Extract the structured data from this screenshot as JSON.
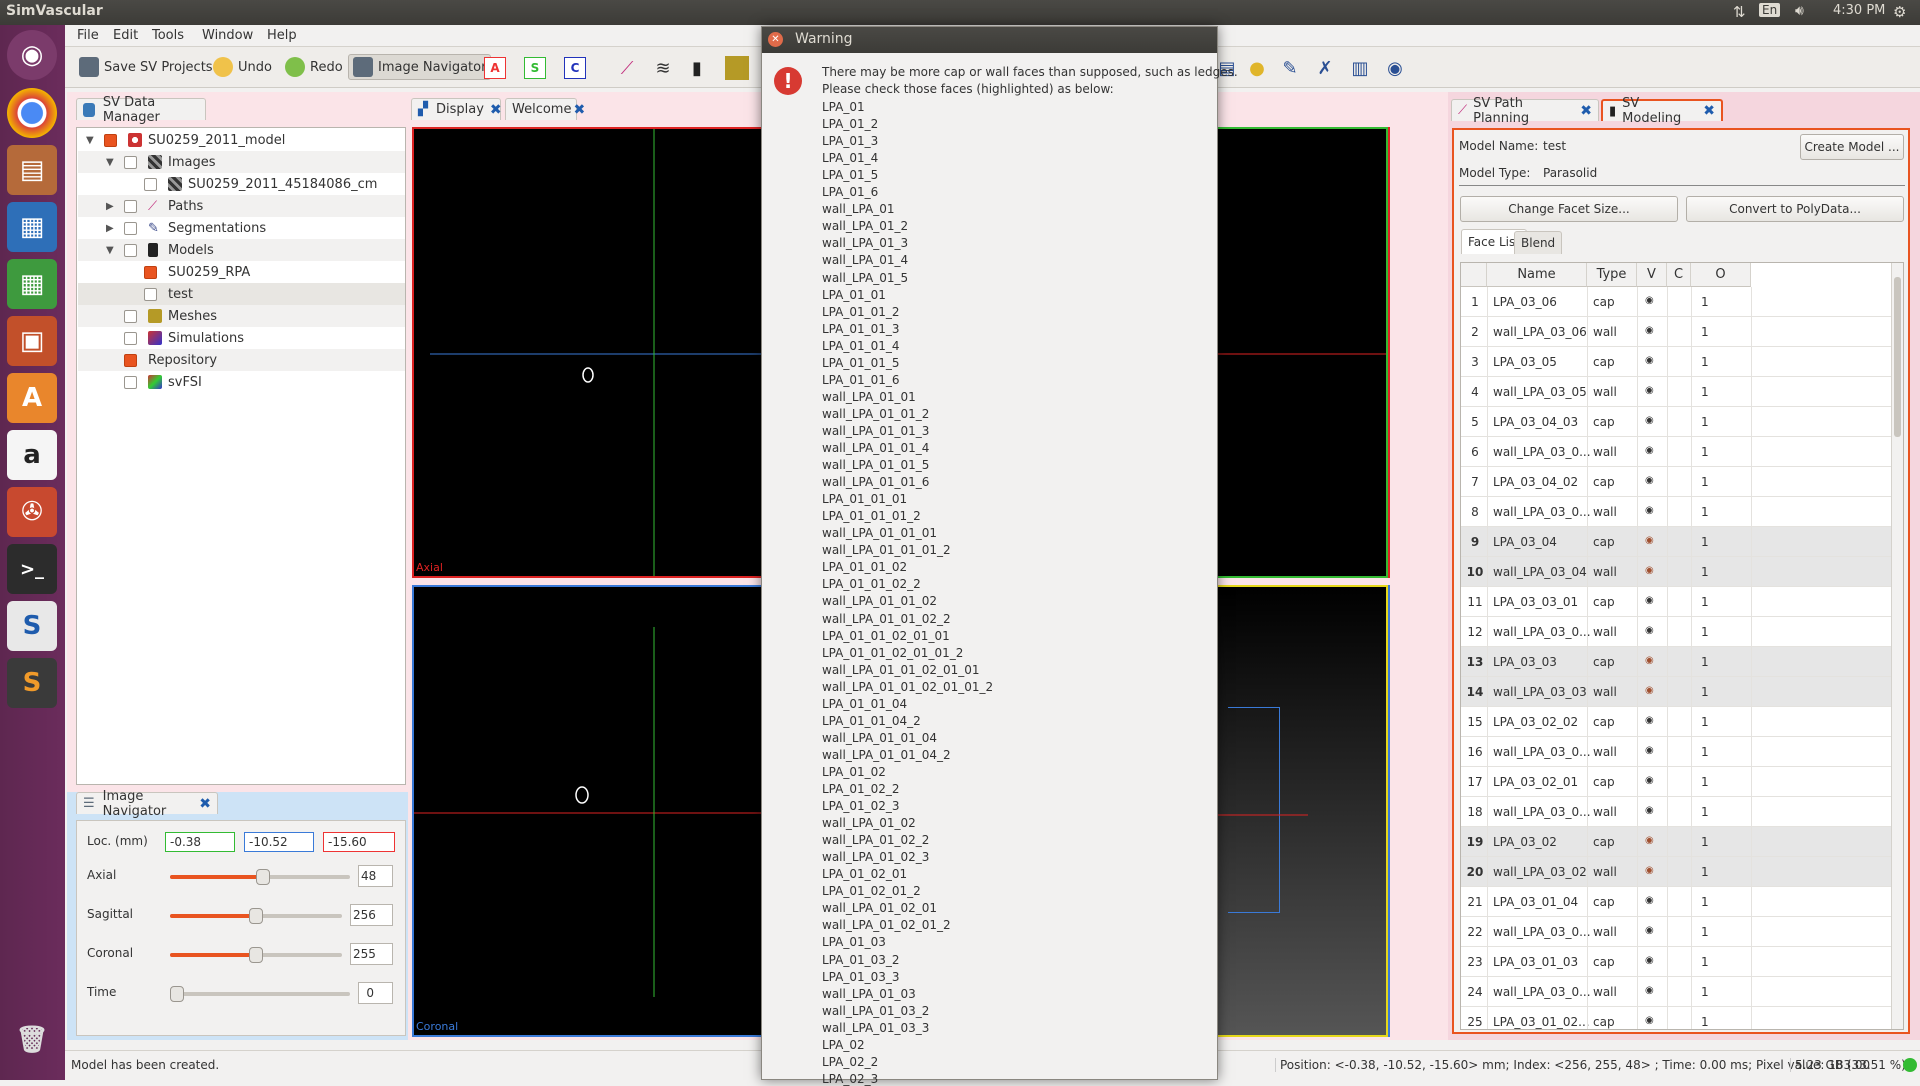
{
  "topbar": {
    "app_title": "SimVascular",
    "keyboard": "En",
    "time": "4:30 PM"
  },
  "launcher": {
    "items": [
      "ubuntu-logo-icon",
      "chrome-icon",
      "files-icon",
      "writer-icon",
      "calc-icon",
      "impress-icon",
      "software-center-icon",
      "amazon-icon",
      "settings-icon",
      "terminal-icon",
      "simvascular-icon",
      "sublime-icon",
      "trash-icon"
    ]
  },
  "menubar": {
    "file": "File",
    "edit": "Edit",
    "tools": "Tools",
    "window": "Window",
    "help": "Help"
  },
  "toolbar": {
    "save": "Save SV Projects",
    "undo": "Undo",
    "redo": "Redo",
    "image_navigator": "Image Navigator",
    "view_a": "A",
    "view_s": "S",
    "view_c": "C"
  },
  "left_dock": {
    "data_manager_tab": "SV Data Manager",
    "tree": [
      {
        "label": "SU0259_2011_model",
        "level": 0,
        "expanded": true
      },
      {
        "label": "Images",
        "level": 1,
        "expanded": true
      },
      {
        "label": "SU0259_2011_45184086_cm",
        "level": 2
      },
      {
        "label": "Paths",
        "level": 1,
        "expanded": false
      },
      {
        "label": "Segmentations",
        "level": 1,
        "expanded": false
      },
      {
        "label": "Models",
        "level": 1,
        "expanded": true
      },
      {
        "label": "SU0259_RPA",
        "level": 2
      },
      {
        "label": "test",
        "level": 2
      },
      {
        "label": "Meshes",
        "level": 1
      },
      {
        "label": "Simulations",
        "level": 1
      },
      {
        "label": "Repository",
        "level": 1
      },
      {
        "label": "svFSI",
        "level": 1
      }
    ]
  },
  "image_navigator": {
    "tab": "Image Navigator",
    "loc_label": "Loc. (mm)",
    "loc_x": "-0.38",
    "loc_y": "-10.52",
    "loc_z": "-15.60",
    "axial_label": "Axial",
    "axial_value": "48",
    "axial_level": 0.52,
    "sagittal_label": "Sagittal",
    "sagittal_value": "256",
    "sagittal_level": 0.5,
    "coronal_label": "Coronal",
    "coronal_value": "255",
    "coronal_level": 0.5,
    "time_label": "Time",
    "time_value": "0",
    "time_level": 0
  },
  "display": {
    "tab_display": "Display",
    "tab_welcome": "Welcome",
    "axial_caption": "Axial",
    "coronal_caption": "Coronal"
  },
  "right_dock": {
    "path_planning_tab": "SV Path Planning",
    "modeling_tab": "SV Modeling",
    "model_name_label": "Model Name:",
    "model_name": "test",
    "model_type_label": "Model Type:",
    "model_type": "Parasolid",
    "create_model": "Create Model ...",
    "change_facet": "Change Facet Size...",
    "convert_polydata": "Convert to PolyData...",
    "face_list_tab": "Face List",
    "blend_tab": "Blend",
    "columns": [
      "Name",
      "Type",
      "V",
      "C",
      "O"
    ],
    "faces": [
      {
        "n": "1",
        "name": "LPA_03_06",
        "type": "cap",
        "o": "1",
        "hl": false
      },
      {
        "n": "2",
        "name": "wall_LPA_03_06",
        "type": "wall",
        "o": "1",
        "hl": false
      },
      {
        "n": "3",
        "name": "LPA_03_05",
        "type": "cap",
        "o": "1",
        "hl": false
      },
      {
        "n": "4",
        "name": "wall_LPA_03_05",
        "type": "wall",
        "o": "1",
        "hl": false
      },
      {
        "n": "5",
        "name": "LPA_03_04_03",
        "type": "cap",
        "o": "1",
        "hl": false
      },
      {
        "n": "6",
        "name": "wall_LPA_03_0...",
        "type": "wall",
        "o": "1",
        "hl": false
      },
      {
        "n": "7",
        "name": "LPA_03_04_02",
        "type": "cap",
        "o": "1",
        "hl": false
      },
      {
        "n": "8",
        "name": "wall_LPA_03_0...",
        "type": "wall",
        "o": "1",
        "hl": false
      },
      {
        "n": "9",
        "name": "LPA_03_04",
        "type": "cap",
        "o": "1",
        "hl": true
      },
      {
        "n": "10",
        "name": "wall_LPA_03_04",
        "type": "wall",
        "o": "1",
        "hl": true
      },
      {
        "n": "11",
        "name": "LPA_03_03_01",
        "type": "cap",
        "o": "1",
        "hl": false
      },
      {
        "n": "12",
        "name": "wall_LPA_03_0...",
        "type": "wall",
        "o": "1",
        "hl": false
      },
      {
        "n": "13",
        "name": "LPA_03_03",
        "type": "cap",
        "o": "1",
        "hl": true
      },
      {
        "n": "14",
        "name": "wall_LPA_03_03",
        "type": "wall",
        "o": "1",
        "hl": true
      },
      {
        "n": "15",
        "name": "LPA_03_02_02",
        "type": "cap",
        "o": "1",
        "hl": false
      },
      {
        "n": "16",
        "name": "wall_LPA_03_0...",
        "type": "wall",
        "o": "1",
        "hl": false
      },
      {
        "n": "17",
        "name": "LPA_03_02_01",
        "type": "cap",
        "o": "1",
        "hl": false
      },
      {
        "n": "18",
        "name": "wall_LPA_03_0...",
        "type": "wall",
        "o": "1",
        "hl": false
      },
      {
        "n": "19",
        "name": "LPA_03_02",
        "type": "cap",
        "o": "1",
        "hl": true
      },
      {
        "n": "20",
        "name": "wall_LPA_03_02",
        "type": "wall",
        "o": "1",
        "hl": true
      },
      {
        "n": "21",
        "name": "LPA_03_01_04",
        "type": "cap",
        "o": "1",
        "hl": false
      },
      {
        "n": "22",
        "name": "wall_LPA_03_0...",
        "type": "wall",
        "o": "1",
        "hl": false
      },
      {
        "n": "23",
        "name": "LPA_03_01_03",
        "type": "cap",
        "o": "1",
        "hl": false
      },
      {
        "n": "24",
        "name": "wall_LPA_03_0...",
        "type": "wall",
        "o": "1",
        "hl": false
      },
      {
        "n": "25",
        "name": "LPA_03_01_02...",
        "type": "cap",
        "o": "1",
        "hl": false
      }
    ]
  },
  "status": {
    "message": "Model has been created.",
    "position": "Position: <-0.38, -10.52, -15.60> mm; Index: <256, 255, 48> ; Time: 0.00 ms; Pixel value: 183.00",
    "memory": "5.23 GB (33.51 %)"
  },
  "warning_dialog": {
    "title": "Warning",
    "message_1": "There may be more cap or wall faces than supposed, such as ledges.",
    "message_2": "Please check those faces (highlighted) as below:",
    "faces": [
      "LPA_01",
      "LPA_01_2",
      "LPA_01_3",
      "LPA_01_4",
      "LPA_01_5",
      "LPA_01_6",
      "wall_LPA_01",
      "wall_LPA_01_2",
      "wall_LPA_01_3",
      "wall_LPA_01_4",
      "wall_LPA_01_5",
      "LPA_01_01",
      "LPA_01_01_2",
      "LPA_01_01_3",
      "LPA_01_01_4",
      "LPA_01_01_5",
      "LPA_01_01_6",
      "wall_LPA_01_01",
      "wall_LPA_01_01_2",
      "wall_LPA_01_01_3",
      "wall_LPA_01_01_4",
      "wall_LPA_01_01_5",
      "wall_LPA_01_01_6",
      "LPA_01_01_01",
      "LPA_01_01_01_2",
      "wall_LPA_01_01_01",
      "wall_LPA_01_01_01_2",
      "LPA_01_01_02",
      "LPA_01_01_02_2",
      "wall_LPA_01_01_02",
      "wall_LPA_01_01_02_2",
      "LPA_01_01_02_01_01",
      "LPA_01_01_02_01_01_2",
      "wall_LPA_01_01_02_01_01",
      "wall_LPA_01_01_02_01_01_2",
      "LPA_01_01_04",
      "LPA_01_01_04_2",
      "wall_LPA_01_01_04",
      "wall_LPA_01_01_04_2",
      "LPA_01_02",
      "LPA_01_02_2",
      "LPA_01_02_3",
      "wall_LPA_01_02",
      "wall_LPA_01_02_2",
      "wall_LPA_01_02_3",
      "LPA_01_02_01",
      "LPA_01_02_01_2",
      "wall_LPA_01_02_01",
      "wall_LPA_01_02_01_2",
      "LPA_01_03",
      "LPA_01_03_2",
      "LPA_01_03_3",
      "wall_LPA_01_03",
      "wall_LPA_01_03_2",
      "wall_LPA_01_03_3",
      "LPA_02",
      "LPA_02_2",
      "LPA_02_3"
    ]
  }
}
